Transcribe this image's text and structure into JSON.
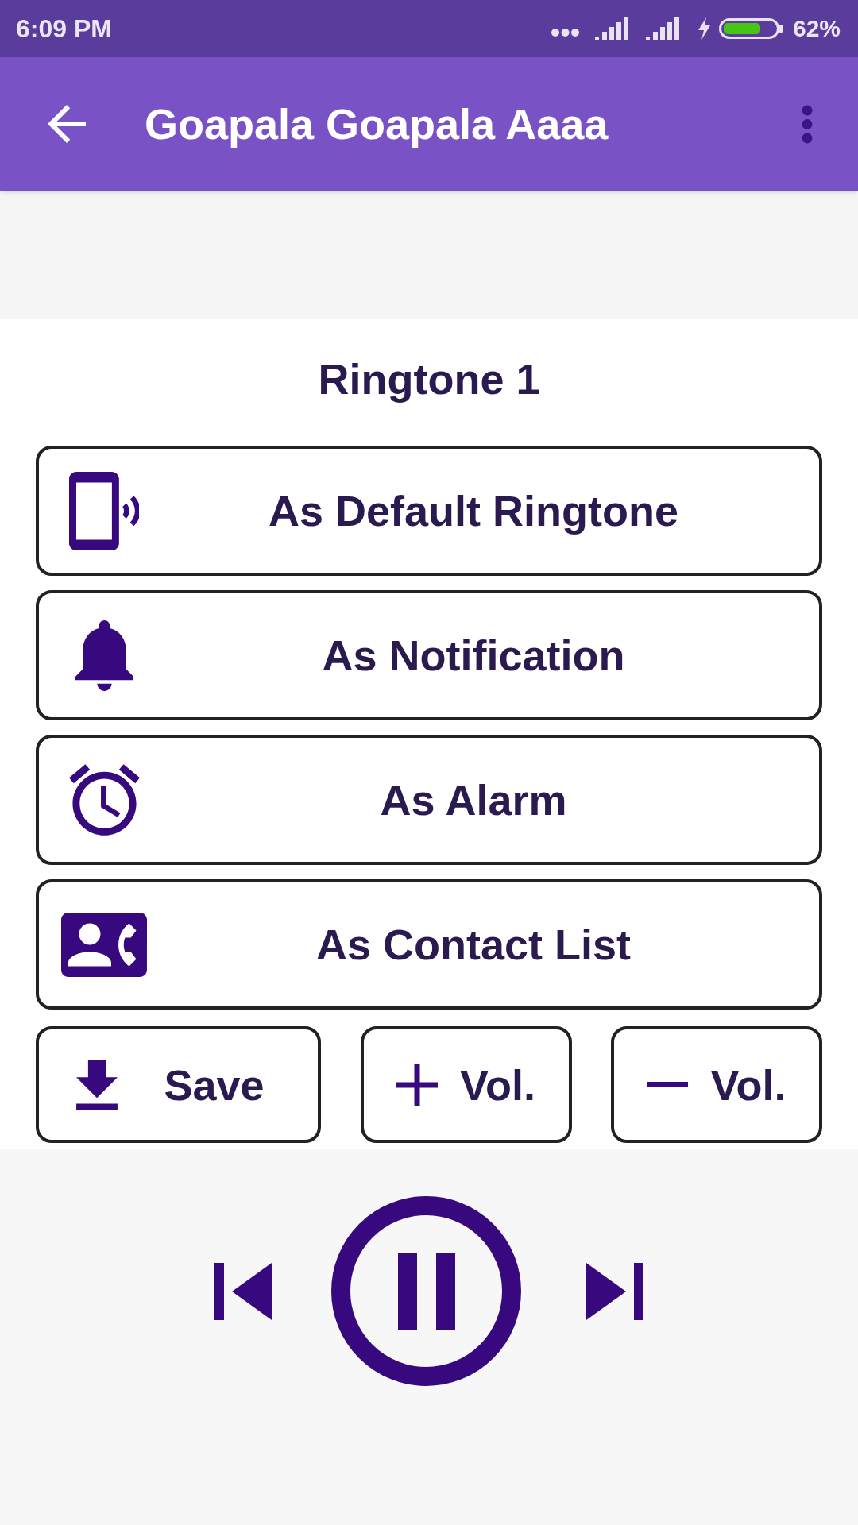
{
  "status_bar": {
    "time": "6:09 PM",
    "battery": "62%"
  },
  "app_bar": {
    "title": "Goapala Goapala Aaaa"
  },
  "ringtone": {
    "title": "Ringtone 1"
  },
  "set_as_buttons": [
    {
      "kind": "phone",
      "label": "As Default Ringtone"
    },
    {
      "kind": "bell",
      "label": "As Notification"
    },
    {
      "kind": "alarm",
      "label": "As Alarm"
    },
    {
      "kind": "contact",
      "label": "As Contact List"
    }
  ],
  "action_buttons": [
    {
      "kind": "save",
      "label": "Save"
    },
    {
      "kind": "volume_up",
      "label": "Vol."
    },
    {
      "kind": "volume_down",
      "label": "Vol."
    }
  ],
  "player": {
    "playing": true
  }
}
